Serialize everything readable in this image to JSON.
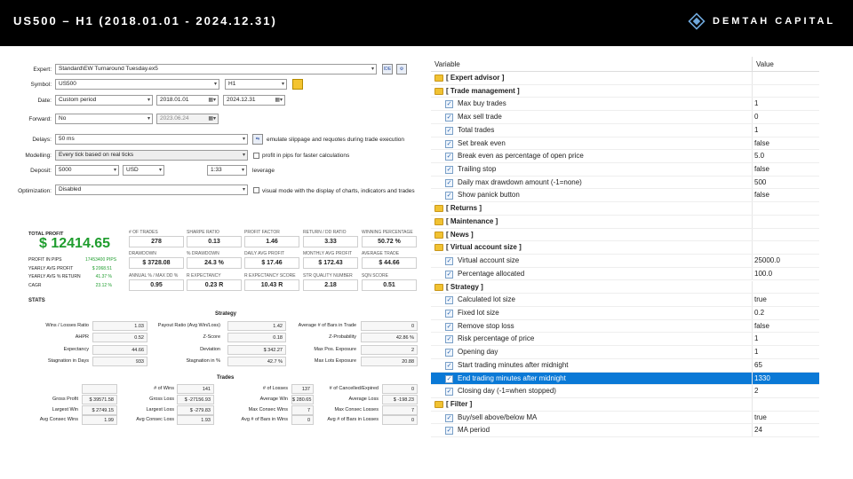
{
  "header": {
    "title": "US500 – H1 (2018.01.01 - 2024.12.31)",
    "brand": "DEMTAH CAPITAL"
  },
  "settings": {
    "expert_label": "Expert:",
    "expert_value": "Standard\\EW Turnaround Tuesday.ex5",
    "symbol_label": "Symbol:",
    "symbol_value": "US500",
    "timeframe_value": "H1",
    "date_label": "Date:",
    "date_mode": "Custom period",
    "date_from": "2018.01.01",
    "date_to": "2024.12.31",
    "forward_label": "Forward:",
    "forward_value": "No",
    "forward_date": "2023.06.24",
    "delays_label": "Delays:",
    "delays_value": "50 ms",
    "delays_note": "emulate slippage and requotes during trade execution",
    "modelling_label": "Modelling:",
    "modelling_value": "Every tick based on real ticks",
    "modelling_note": "profit in pips for faster calculations",
    "deposit_label": "Deposit:",
    "deposit_value": "5000",
    "currency_value": "USD",
    "leverage_value": "1:33",
    "leverage_label": "leverage",
    "optimization_label": "Optimization:",
    "optimization_value": "Disabled",
    "visual_note": "visual mode with the display of charts, indicators and trades",
    "ide_btn": "IDE"
  },
  "summary": {
    "total_profit_label": "TOTAL PROFIT",
    "total_profit": "$ 12414.65",
    "left_rows": [
      {
        "label": "PROFIT IN PIPS",
        "value": "17453400 PIPS"
      },
      {
        "label": "YEARLY AVG PROFIT",
        "value": "$ 2068.51"
      },
      {
        "label": "YEARLY AVG % RETURN",
        "value": "41.37 %"
      },
      {
        "label": "CAGR",
        "value": "23.12 %"
      }
    ],
    "stats_label": "STATS",
    "metrics": [
      {
        "label": "# OF TRADES",
        "value": "278"
      },
      {
        "label": "SHARPE RATIO",
        "value": "0.13"
      },
      {
        "label": "PROFIT FACTOR",
        "value": "1.46"
      },
      {
        "label": "RETURN / DD RATIO",
        "value": "3.33"
      },
      {
        "label": "WINNING PERCENTAGE",
        "value": "50.72 %"
      },
      {
        "label": "DRAWDOWN",
        "value": "$ 3728.08"
      },
      {
        "label": "% DRAWDOWN",
        "value": "24.3 %"
      },
      {
        "label": "DAILY AVG PROFIT",
        "value": "$ 17.46"
      },
      {
        "label": "MONTHLY AVG PROFIT",
        "value": "$ 172.43"
      },
      {
        "label": "AVERAGE TRADE",
        "value": "$ 44.66"
      },
      {
        "label": "ANNUAL % / MAX DD %",
        "value": "0.95"
      },
      {
        "label": "R EXPECTANCY",
        "value": "0.23 R"
      },
      {
        "label": "R EXPECTANCY SCORE",
        "value": "10.43 R"
      },
      {
        "label": "STR QUALITY NUMBER",
        "value": "2.18"
      },
      {
        "label": "SQN SCORE",
        "value": "0.51"
      }
    ]
  },
  "strategy": {
    "title": "Strategy",
    "rows": [
      [
        "Wins / Losses Ratio",
        "1.03",
        "Payout Ratio (Avg Win/Loss)",
        "1.42",
        "Average # of Bars in Trade",
        "0"
      ],
      [
        "AHPR",
        "0.52",
        "Z-Score",
        "0.18",
        "Z-Probability",
        "42.86 %"
      ],
      [
        "Expectancy",
        "44.66",
        "Deviation",
        "$ 342.27",
        "Max Pos. Exposure",
        "2"
      ],
      [
        "Stagnation in Days",
        "933",
        "Stagnation in %",
        "42.7 %",
        "Max Lots Exposure",
        "20.88"
      ]
    ]
  },
  "trades": {
    "title": "Trades",
    "rows": [
      [
        "",
        "",
        "# of Wins",
        "141",
        "# of Losses",
        "137",
        "# of Cancelled/Expired",
        "0"
      ],
      [
        "Gross Profit",
        "$ 39571.58",
        "Gross Loss",
        "$ -27156.93",
        "Average Win",
        "$ 280.65",
        "Average Loss",
        "$ -198.23"
      ],
      [
        "Largest Win",
        "$ 2749.15",
        "Largest Loss",
        "$ -279.83",
        "Max Consec Wins",
        "7",
        "Max Consec Losses",
        "7"
      ],
      [
        "Avg Consec Wins",
        "1.99",
        "Avg Consec Loss",
        "1.93",
        "Avg # of Bars in Wins",
        "0",
        "Avg # of Bars in Losses",
        "0"
      ]
    ]
  },
  "params": {
    "col_variable": "Variable",
    "col_value": "Value",
    "rows": [
      {
        "type": "group",
        "name": "[ Expert advisor ]"
      },
      {
        "type": "group",
        "name": "[ Trade management ]"
      },
      {
        "type": "item",
        "name": "Max buy trades",
        "value": "1"
      },
      {
        "type": "item",
        "name": "Max sell trade",
        "value": "0"
      },
      {
        "type": "item",
        "name": "Total trades",
        "value": "1"
      },
      {
        "type": "item",
        "name": "Set break even",
        "value": "false"
      },
      {
        "type": "item",
        "name": "Break even as percentage of open price",
        "value": "5.0"
      },
      {
        "type": "item",
        "name": "Trailing stop",
        "value": "false"
      },
      {
        "type": "item",
        "name": "Daily max drawdown amount (-1=none)",
        "value": "500"
      },
      {
        "type": "item",
        "name": "Show panick button",
        "value": "false"
      },
      {
        "type": "group",
        "name": "[ Returns ]"
      },
      {
        "type": "group",
        "name": "[ Maintenance ]"
      },
      {
        "type": "group",
        "name": "[ News ]"
      },
      {
        "type": "group",
        "name": "[ Virtual account size ]"
      },
      {
        "type": "item",
        "name": "Virtual account size",
        "value": "25000.0"
      },
      {
        "type": "item",
        "name": "Percentage allocated",
        "value": "100.0"
      },
      {
        "type": "group",
        "name": "[ Strategy ]"
      },
      {
        "type": "item",
        "name": "Calculated lot size",
        "value": "true"
      },
      {
        "type": "item",
        "name": "Fixed lot size",
        "value": "0.2"
      },
      {
        "type": "item",
        "name": "Remove stop loss",
        "value": "false"
      },
      {
        "type": "item",
        "name": "Risk percentage of price",
        "value": "1"
      },
      {
        "type": "item",
        "name": "Opening day",
        "value": "1"
      },
      {
        "type": "item",
        "name": "Start trading minutes after midnight",
        "value": "65"
      },
      {
        "type": "item",
        "name": "End trading minutes after midnight",
        "value": "1330",
        "selected": true
      },
      {
        "type": "item",
        "name": "Closing day (-1=when stopped)",
        "value": "2"
      },
      {
        "type": "group",
        "name": "[ Filter ]"
      },
      {
        "type": "item",
        "name": "Buy/sell above/below MA",
        "value": "true"
      },
      {
        "type": "item",
        "name": "MA period",
        "value": "24"
      }
    ]
  },
  "colors": {
    "accent_green": "#1f9d2e",
    "selection_blue": "#0a79d6",
    "folder": "#f1c232"
  },
  "icons": [
    "diamond-logo-icon",
    "folder-icon",
    "checkbox-icon",
    "calendar-icon",
    "gear-icon",
    "dropdown-icon"
  ]
}
